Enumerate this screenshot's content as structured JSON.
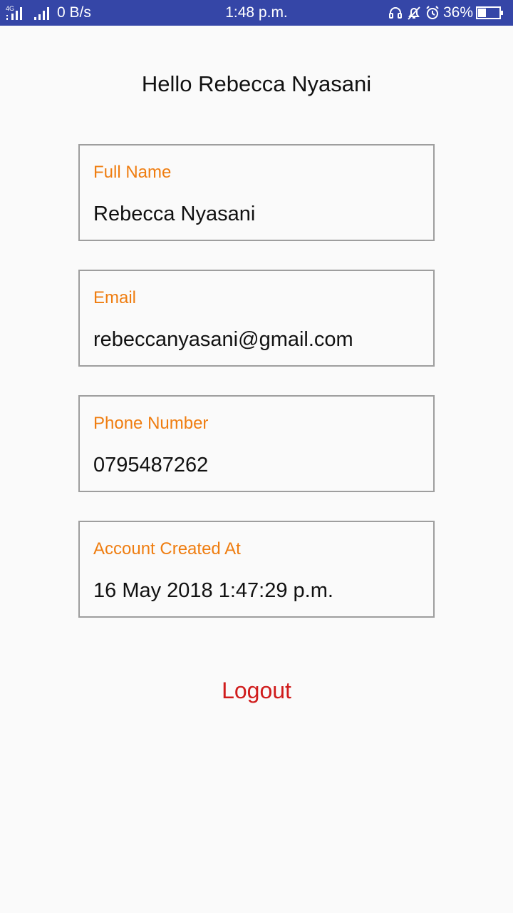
{
  "status_bar": {
    "network_type": "4G",
    "data_rate": "0 B/s",
    "time": "1:48 p.m.",
    "battery_percent": "36%",
    "background_color": "#3546a7"
  },
  "greeting": "Hello Rebecca Nyasani",
  "fields": [
    {
      "label": "Full Name",
      "value": "Rebecca Nyasani"
    },
    {
      "label": "Email",
      "value": "rebeccanyasani@gmail.com"
    },
    {
      "label": "Phone Number",
      "value": "0795487262"
    },
    {
      "label": "Account Created At",
      "value": "16 May 2018 1:47:29 p.m."
    }
  ],
  "logout_label": "Logout",
  "colors": {
    "label": "#ef7d10",
    "logout": "#d01c1c",
    "border": "#9e9e9e"
  },
  "icons": [
    "signal-icon",
    "signal-icon",
    "headset-icon",
    "muted-bell-icon",
    "alarm-icon",
    "battery-icon"
  ]
}
